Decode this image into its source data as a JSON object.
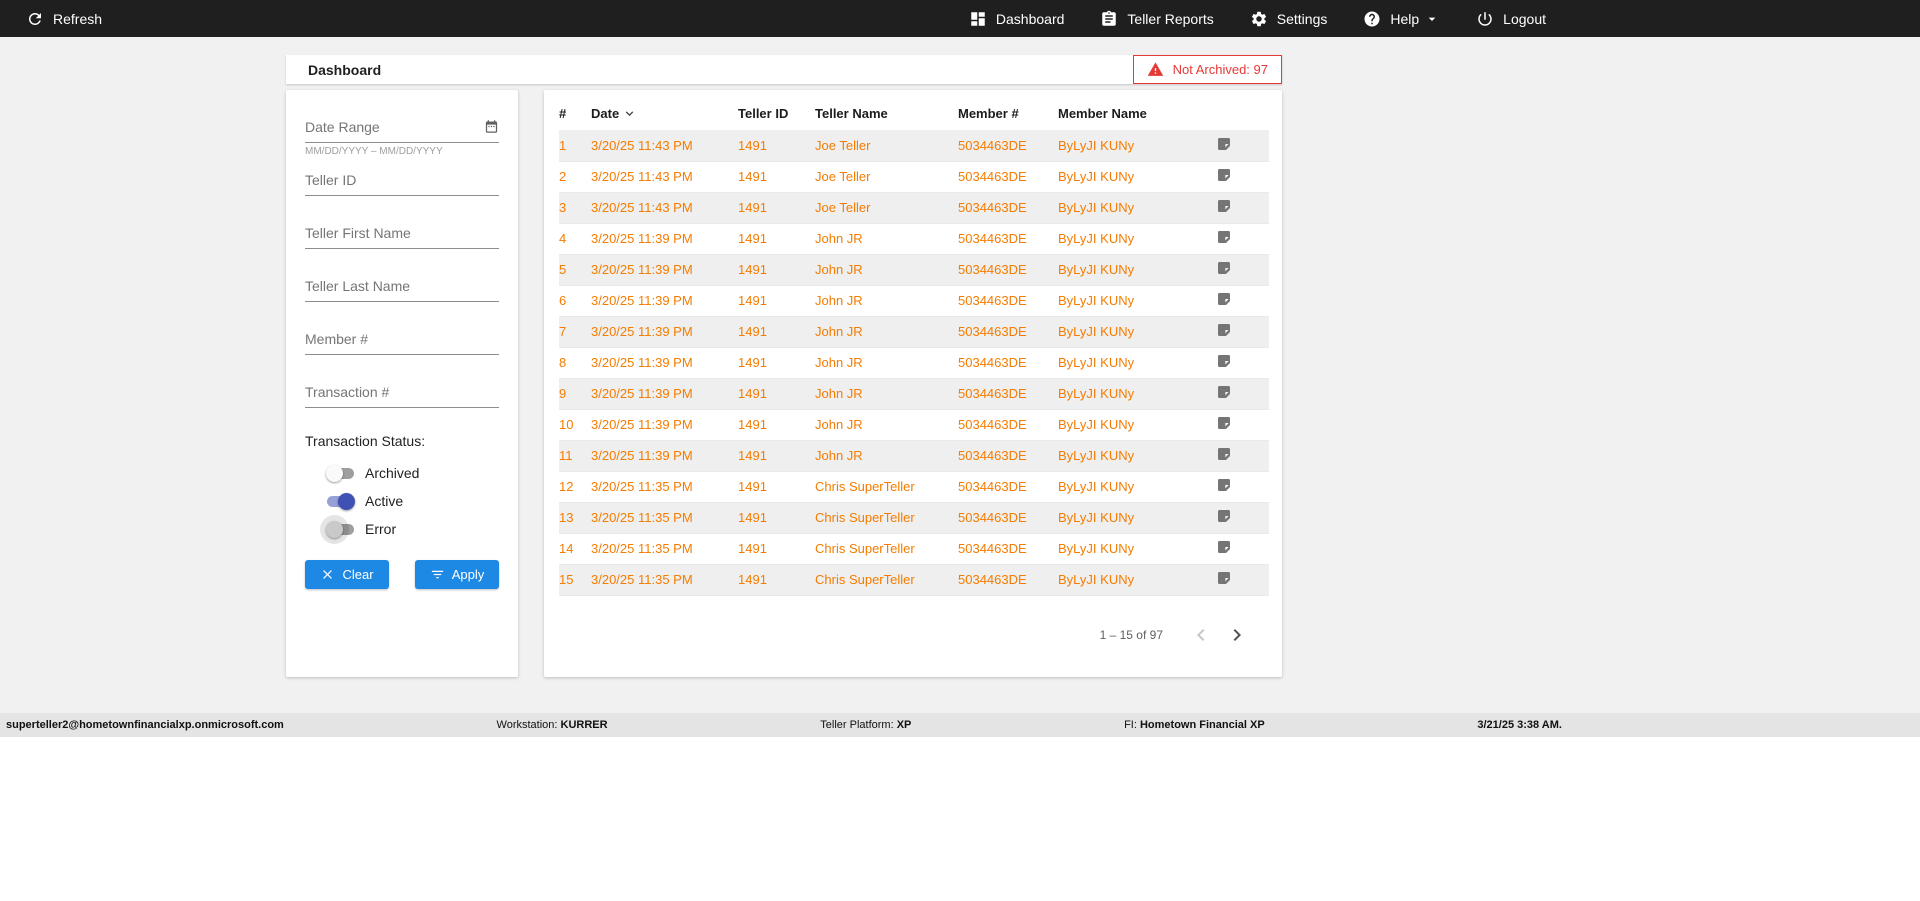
{
  "topbar": {
    "refresh_label": "Refresh",
    "dashboard_label": "Dashboard",
    "reports_label": "Teller Reports",
    "settings_label": "Settings",
    "help_label": "Help",
    "logout_label": "Logout"
  },
  "header": {
    "title": "Dashboard",
    "not_archived_badge": "Not Archived: 97"
  },
  "filters": {
    "date_range_placeholder": "Date Range",
    "date_range_helper": "MM/DD/YYYY – MM/DD/YYYY",
    "teller_id_placeholder": "Teller ID",
    "teller_first_name_placeholder": "Teller First Name",
    "teller_last_name_placeholder": "Teller Last Name",
    "member_number_placeholder": "Member #",
    "transaction_number_placeholder": "Transaction #",
    "status_heading": "Transaction Status:",
    "toggles": [
      {
        "label": "Archived",
        "state": "off"
      },
      {
        "label": "Active",
        "state": "on"
      },
      {
        "label": "Error",
        "state": "off"
      }
    ],
    "clear_button": "Clear",
    "apply_button": "Apply"
  },
  "table": {
    "columns": [
      "#",
      "Date",
      "Teller ID",
      "Teller Name",
      "Member #",
      "Member Name"
    ],
    "sorted_by": "Date",
    "sort_direction": "desc",
    "rows": [
      {
        "num": "1",
        "date": "3/20/25 11:43 PM",
        "teller_id": "1491",
        "teller_name": "Joe Teller",
        "member_number": "5034463DE",
        "member_name": "ByLyJI KUNy"
      },
      {
        "num": "2",
        "date": "3/20/25 11:43 PM",
        "teller_id": "1491",
        "teller_name": "Joe Teller",
        "member_number": "5034463DE",
        "member_name": "ByLyJI KUNy"
      },
      {
        "num": "3",
        "date": "3/20/25 11:43 PM",
        "teller_id": "1491",
        "teller_name": "Joe Teller",
        "member_number": "5034463DE",
        "member_name": "ByLyJI KUNy"
      },
      {
        "num": "4",
        "date": "3/20/25 11:39 PM",
        "teller_id": "1491",
        "teller_name": "John JR",
        "member_number": "5034463DE",
        "member_name": "ByLyJI KUNy"
      },
      {
        "num": "5",
        "date": "3/20/25 11:39 PM",
        "teller_id": "1491",
        "teller_name": "John JR",
        "member_number": "5034463DE",
        "member_name": "ByLyJI KUNy"
      },
      {
        "num": "6",
        "date": "3/20/25 11:39 PM",
        "teller_id": "1491",
        "teller_name": "John JR",
        "member_number": "5034463DE",
        "member_name": "ByLyJI KUNy"
      },
      {
        "num": "7",
        "date": "3/20/25 11:39 PM",
        "teller_id": "1491",
        "teller_name": "John JR",
        "member_number": "5034463DE",
        "member_name": "ByLyJI KUNy"
      },
      {
        "num": "8",
        "date": "3/20/25 11:39 PM",
        "teller_id": "1491",
        "teller_name": "John JR",
        "member_number": "5034463DE",
        "member_name": "ByLyJI KUNy"
      },
      {
        "num": "9",
        "date": "3/20/25 11:39 PM",
        "teller_id": "1491",
        "teller_name": "John JR",
        "member_number": "5034463DE",
        "member_name": "ByLyJI KUNy"
      },
      {
        "num": "10",
        "date": "3/20/25 11:39 PM",
        "teller_id": "1491",
        "teller_name": "John JR",
        "member_number": "5034463DE",
        "member_name": "ByLyJI KUNy"
      },
      {
        "num": "11",
        "date": "3/20/25 11:39 PM",
        "teller_id": "1491",
        "teller_name": "John JR",
        "member_number": "5034463DE",
        "member_name": "ByLyJI KUNy"
      },
      {
        "num": "12",
        "date": "3/20/25 11:35 PM",
        "teller_id": "1491",
        "teller_name": "Chris SuperTeller",
        "member_number": "5034463DE",
        "member_name": "ByLyJI KUNy"
      },
      {
        "num": "13",
        "date": "3/20/25 11:35 PM",
        "teller_id": "1491",
        "teller_name": "Chris SuperTeller",
        "member_number": "5034463DE",
        "member_name": "ByLyJI KUNy"
      },
      {
        "num": "14",
        "date": "3/20/25 11:35 PM",
        "teller_id": "1491",
        "teller_name": "Chris SuperTeller",
        "member_number": "5034463DE",
        "member_name": "ByLyJI KUNy"
      },
      {
        "num": "15",
        "date": "3/20/25 11:35 PM",
        "teller_id": "1491",
        "teller_name": "Chris SuperTeller",
        "member_number": "5034463DE",
        "member_name": "ByLyJI KUNy"
      }
    ],
    "pagination": {
      "range_label": "1 – 15 of 97"
    }
  },
  "statusbar": {
    "user_email": "superteller2@hometownfinancialxp.onmicrosoft.com",
    "workstation_label": "Workstation:",
    "workstation_value": "KURRER",
    "platform_label": "Teller Platform:",
    "platform_value": "XP",
    "fi_label": "FI:",
    "fi_value": "Hometown Financial XP",
    "datetime": "3/21/25 3:38 AM."
  },
  "colors": {
    "accent_orange": "#F57C00",
    "primary_blue": "#1E88E5",
    "alert_red": "#E53935",
    "toggle_active_blue": "#3F51B5",
    "topbar_bg": "#1F1F1F"
  }
}
